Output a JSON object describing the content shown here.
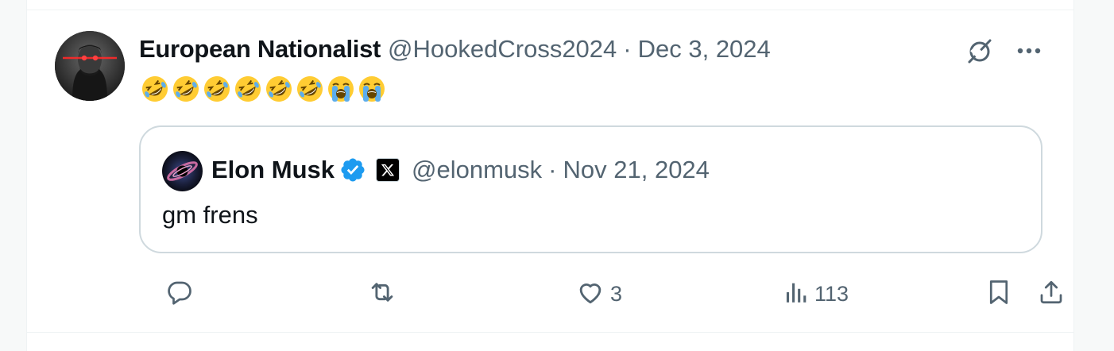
{
  "tweet": {
    "author": {
      "display_name": "European Nationalist",
      "handle": "@HookedCross2024"
    },
    "separator": "·",
    "date": "Dec 3, 2024",
    "emojis": [
      "rolling-on-floor-laughing",
      "rolling-on-floor-laughing",
      "rolling-on-floor-laughing",
      "rolling-on-floor-laughing",
      "rolling-on-floor-laughing",
      "rolling-on-floor-laughing",
      "loudly-crying",
      "loudly-crying"
    ],
    "quote": {
      "author": {
        "display_name": "Elon Musk",
        "handle": "@elonmusk",
        "verified": true
      },
      "separator": "·",
      "date": "Nov 21, 2024",
      "text": "gm frens"
    },
    "actions": {
      "reply_count": "",
      "retweet_count": "",
      "like_count": "3",
      "view_count": "113"
    }
  },
  "colors": {
    "text_primary": "#0f1419",
    "text_secondary": "#536471",
    "border": "#cfd9de",
    "verified": "#1d9bf0",
    "laser": "#ff2a2a"
  }
}
